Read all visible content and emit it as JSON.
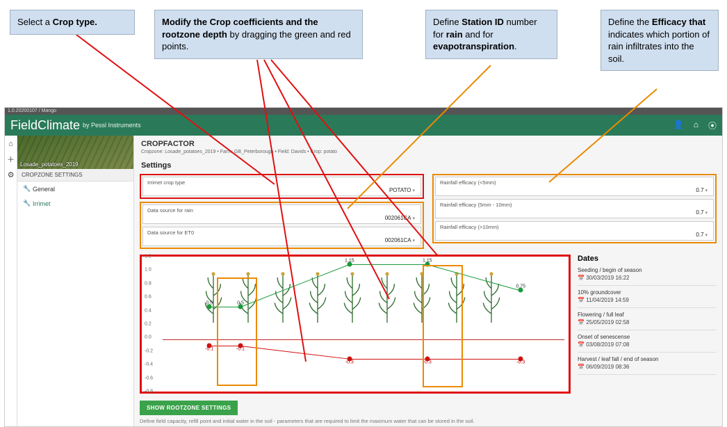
{
  "callouts": {
    "crop_type": "Select a <b>Crop type.</b>",
    "coeff": "<b>Modify the Crop coefficients and the rootzone depth</b> by dragging the green and red points.",
    "station": "Define <b>Station ID</b> number for <b>rain</b> and for <b>evapotranspiration</b>.",
    "efficacy": "Define the <b>Efficacy that</b> indicates which portion of rain infiltrates into the soil."
  },
  "titlebar": "1.0.20200107 / Mango",
  "brand": {
    "name": "FieldClimate",
    "by": "by Pessl Instruments"
  },
  "sidebar": {
    "cropzone_caption": "Losade_potatoes_2019",
    "heading": "CROPZONE SETTINGS",
    "items": [
      {
        "icon": "wrench-icon",
        "label": "General"
      },
      {
        "icon": "wrench-icon",
        "label": "Irrimet"
      }
    ]
  },
  "crumbs": {
    "title": "CROPFACTOR",
    "path": "Cropzone: Losade_potatoes_2019 • Farm: GB_Peterborough • Field: Davids • Crop: potato"
  },
  "settings_heading": "Settings",
  "left_fields": {
    "crop_type": {
      "label": "Irrimet crop type",
      "value": "POTATO"
    },
    "rain_src": {
      "label": "Data source for rain",
      "value": "002061CA"
    },
    "et0_src": {
      "label": "Data source for ET0",
      "value": "002061CA"
    }
  },
  "right_fields": {
    "eff_lt5": {
      "label": "Rainfall efficacy (<5mm)",
      "value": "0.7"
    },
    "eff_5_10": {
      "label": "Rainfall efficacy (5mm - 10mm)",
      "value": "0.7"
    },
    "eff_gt10": {
      "label": "Rainfall efficacy (>10mm)",
      "value": "0.7"
    }
  },
  "chart_data": {
    "type": "line",
    "y_ticks": [
      1.2,
      1.0,
      0.8,
      0.6,
      0.4,
      0.2,
      0.0,
      -0.2,
      -0.4,
      -0.6,
      -0.8
    ],
    "ylim": [
      -0.8,
      1.2
    ],
    "series": [
      {
        "name": "crop_coefficient",
        "color": "#1a9a3a",
        "points": [
          {
            "stage": "seeding",
            "value": 0.5
          },
          {
            "stage": "10pct_groundcover",
            "value": 0.5
          },
          {
            "stage": "flowering_full_leaf",
            "value": 1.15
          },
          {
            "stage": "onset_senescence",
            "value": 1.15
          },
          {
            "stage": "harvest",
            "value": 0.75
          }
        ]
      },
      {
        "name": "rootzone_depth_m",
        "color": "#d01010",
        "points": [
          {
            "stage": "seeding",
            "value": -0.1
          },
          {
            "stage": "10pct_groundcover",
            "value": -0.1
          },
          {
            "stage": "flowering_full_leaf",
            "value": -0.3
          },
          {
            "stage": "onset_senescence",
            "value": -0.3
          },
          {
            "stage": "harvest",
            "value": -0.3
          }
        ]
      }
    ]
  },
  "dates": {
    "heading": "Dates",
    "items": [
      {
        "label": "Seeding / begin of season",
        "value": "30/03/2019 16:22"
      },
      {
        "label": "10% groundcover",
        "value": "11/04/2019 14:59"
      },
      {
        "label": "Flowering / full leaf",
        "value": "25/05/2019 02:58"
      },
      {
        "label": "Onset of senescense",
        "value": "03/08/2019 07:08"
      },
      {
        "label": "Harvest / leaf fall / end of season",
        "value": "06/09/2019 08:36"
      }
    ]
  },
  "rootzone": {
    "button": "SHOW ROOTZONE SETTINGS",
    "hint": "Define field capacity, refill point and initial water in the soil - parameters that are required to limit the maximum water that can be stored in the soil."
  }
}
